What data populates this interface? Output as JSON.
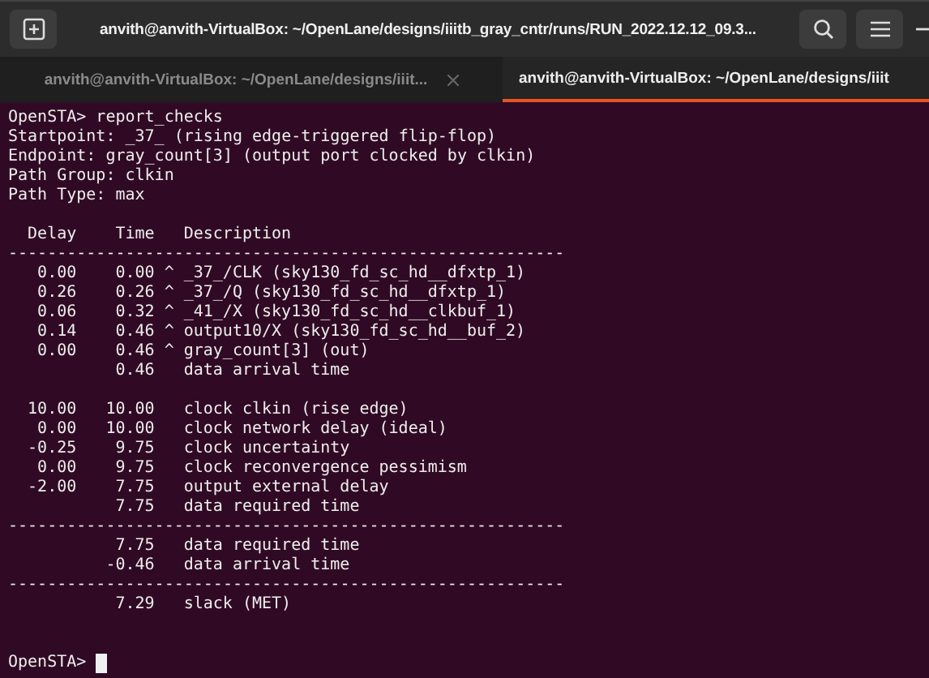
{
  "window": {
    "title": "anvith@anvith-VirtualBox: ~/OpenLane/designs/iiitb_gray_cntr/runs/RUN_2022.12.12_09.3..."
  },
  "tabs": [
    {
      "label": "anvith@anvith-VirtualBox: ~/OpenLane/designs/iiit...",
      "selected": false
    },
    {
      "label": "anvith@anvith-VirtualBox: ~/OpenLane/designs/iiit",
      "selected": true
    }
  ],
  "terminal": {
    "lines": [
      {
        "kind": "text",
        "text": "OpenSTA> report_checks"
      },
      {
        "kind": "text",
        "text": "Startpoint: _37_ (rising edge-triggered flip-flop)"
      },
      {
        "kind": "text",
        "text": "Endpoint: gray_count[3] (output port clocked by clkin)"
      },
      {
        "kind": "text",
        "text": "Path Group: clkin"
      },
      {
        "kind": "text",
        "text": "Path Type: max"
      },
      {
        "kind": "blank"
      },
      {
        "kind": "row",
        "delay": "Delay",
        "time": "Time",
        "description": "Description"
      },
      {
        "kind": "rule",
        "text": "---------------------------------------------------------"
      },
      {
        "kind": "row",
        "delay": "0.00",
        "time": "0.00",
        "edge": "^",
        "description": "_37_/CLK (sky130_fd_sc_hd__dfxtp_1)"
      },
      {
        "kind": "row",
        "delay": "0.26",
        "time": "0.26",
        "edge": "^",
        "description": "_37_/Q (sky130_fd_sc_hd__dfxtp_1)"
      },
      {
        "kind": "row",
        "delay": "0.06",
        "time": "0.32",
        "edge": "^",
        "description": "_41_/X (sky130_fd_sc_hd__clkbuf_1)"
      },
      {
        "kind": "row",
        "delay": "0.14",
        "time": "0.46",
        "edge": "^",
        "description": "output10/X (sky130_fd_sc_hd__buf_2)"
      },
      {
        "kind": "row",
        "delay": "0.00",
        "time": "0.46",
        "edge": "^",
        "description": "gray_count[3] (out)"
      },
      {
        "kind": "row",
        "time": "0.46",
        "description": "data arrival time"
      },
      {
        "kind": "blank"
      },
      {
        "kind": "row",
        "delay": "10.00",
        "time": "10.00",
        "description": "clock clkin (rise edge)"
      },
      {
        "kind": "row",
        "delay": "0.00",
        "time": "10.00",
        "description": "clock network delay (ideal)"
      },
      {
        "kind": "row",
        "delay": "-0.25",
        "time": "9.75",
        "description": "clock uncertainty"
      },
      {
        "kind": "row",
        "delay": "0.00",
        "time": "9.75",
        "description": "clock reconvergence pessimism"
      },
      {
        "kind": "row",
        "delay": "-2.00",
        "time": "7.75",
        "description": "output external delay"
      },
      {
        "kind": "row",
        "time": "7.75",
        "description": "data required time"
      },
      {
        "kind": "rule",
        "text": "---------------------------------------------------------"
      },
      {
        "kind": "row",
        "time": "7.75",
        "description": "data required time"
      },
      {
        "kind": "row",
        "time": "-0.46",
        "description": "data arrival time"
      },
      {
        "kind": "rule",
        "text": "---------------------------------------------------------"
      },
      {
        "kind": "row",
        "time": "7.29",
        "description": "slack (MET)"
      },
      {
        "kind": "blank"
      },
      {
        "kind": "blank"
      },
      {
        "kind": "prompt",
        "text": "OpenSTA>"
      }
    ]
  }
}
